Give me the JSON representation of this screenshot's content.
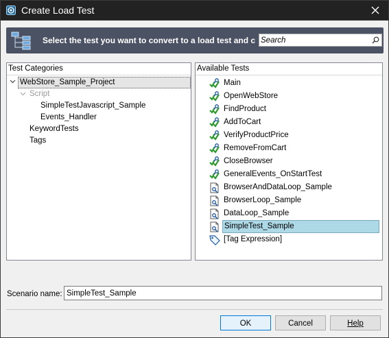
{
  "window": {
    "title": "Create Load Test"
  },
  "banner": {
    "heading": "Select the test you want to convert to a load test and c"
  },
  "search": {
    "placeholder": "Search"
  },
  "left_panel": {
    "header": "Test Categories",
    "project": "WebStore_Sample_Project",
    "script_label": "Script",
    "script_items": [
      "SimpleTestJavascript_Sample",
      "Events_Handler"
    ],
    "keyword_tests": "KeywordTests",
    "tags": "Tags"
  },
  "right_panel": {
    "header": "Available Tests",
    "tests": [
      {
        "label": "Main",
        "icon": "keyword-test-icon"
      },
      {
        "label": "OpenWebStore",
        "icon": "keyword-test-icon"
      },
      {
        "label": "FindProduct",
        "icon": "keyword-test-icon"
      },
      {
        "label": "AddToCart",
        "icon": "keyword-test-icon"
      },
      {
        "label": "VerifyProductPrice",
        "icon": "keyword-test-icon"
      },
      {
        "label": "RemoveFromCart",
        "icon": "keyword-test-icon"
      },
      {
        "label": "CloseBrowser",
        "icon": "keyword-test-icon"
      },
      {
        "label": "GeneralEvents_OnStartTest",
        "icon": "keyword-test-icon"
      },
      {
        "label": "BrowserAndDataLoop_Sample",
        "icon": "script-test-icon"
      },
      {
        "label": "BrowserLoop_Sample",
        "icon": "script-test-icon"
      },
      {
        "label": "DataLoop_Sample",
        "icon": "script-test-icon"
      },
      {
        "label": "SimpleTest_Sample",
        "icon": "script-test-icon",
        "selected": true
      },
      {
        "label": "[Tag Expression]",
        "icon": "tag-icon"
      }
    ]
  },
  "scenario": {
    "label": "Scenario name:",
    "value": "SimpleTest_Sample"
  },
  "buttons": {
    "ok": "OK",
    "cancel": "Cancel",
    "help": "Help"
  },
  "colors": {
    "title_bar": "#222222",
    "banner": "#4b5263",
    "selection": "#add8e6"
  }
}
